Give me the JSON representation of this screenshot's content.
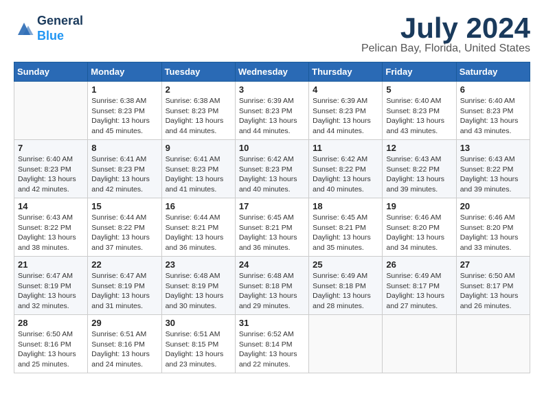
{
  "header": {
    "logo_line1": "General",
    "logo_line2": "Blue",
    "month": "July 2024",
    "location": "Pelican Bay, Florida, United States"
  },
  "weekdays": [
    "Sunday",
    "Monday",
    "Tuesday",
    "Wednesday",
    "Thursday",
    "Friday",
    "Saturday"
  ],
  "weeks": [
    [
      {
        "day": "",
        "info": ""
      },
      {
        "day": "1",
        "info": "Sunrise: 6:38 AM\nSunset: 8:23 PM\nDaylight: 13 hours\nand 45 minutes."
      },
      {
        "day": "2",
        "info": "Sunrise: 6:38 AM\nSunset: 8:23 PM\nDaylight: 13 hours\nand 44 minutes."
      },
      {
        "day": "3",
        "info": "Sunrise: 6:39 AM\nSunset: 8:23 PM\nDaylight: 13 hours\nand 44 minutes."
      },
      {
        "day": "4",
        "info": "Sunrise: 6:39 AM\nSunset: 8:23 PM\nDaylight: 13 hours\nand 44 minutes."
      },
      {
        "day": "5",
        "info": "Sunrise: 6:40 AM\nSunset: 8:23 PM\nDaylight: 13 hours\nand 43 minutes."
      },
      {
        "day": "6",
        "info": "Sunrise: 6:40 AM\nSunset: 8:23 PM\nDaylight: 13 hours\nand 43 minutes."
      }
    ],
    [
      {
        "day": "7",
        "info": "Sunrise: 6:40 AM\nSunset: 8:23 PM\nDaylight: 13 hours\nand 42 minutes."
      },
      {
        "day": "8",
        "info": "Sunrise: 6:41 AM\nSunset: 8:23 PM\nDaylight: 13 hours\nand 42 minutes."
      },
      {
        "day": "9",
        "info": "Sunrise: 6:41 AM\nSunset: 8:23 PM\nDaylight: 13 hours\nand 41 minutes."
      },
      {
        "day": "10",
        "info": "Sunrise: 6:42 AM\nSunset: 8:23 PM\nDaylight: 13 hours\nand 40 minutes."
      },
      {
        "day": "11",
        "info": "Sunrise: 6:42 AM\nSunset: 8:22 PM\nDaylight: 13 hours\nand 40 minutes."
      },
      {
        "day": "12",
        "info": "Sunrise: 6:43 AM\nSunset: 8:22 PM\nDaylight: 13 hours\nand 39 minutes."
      },
      {
        "day": "13",
        "info": "Sunrise: 6:43 AM\nSunset: 8:22 PM\nDaylight: 13 hours\nand 39 minutes."
      }
    ],
    [
      {
        "day": "14",
        "info": "Sunrise: 6:43 AM\nSunset: 8:22 PM\nDaylight: 13 hours\nand 38 minutes."
      },
      {
        "day": "15",
        "info": "Sunrise: 6:44 AM\nSunset: 8:22 PM\nDaylight: 13 hours\nand 37 minutes."
      },
      {
        "day": "16",
        "info": "Sunrise: 6:44 AM\nSunset: 8:21 PM\nDaylight: 13 hours\nand 36 minutes."
      },
      {
        "day": "17",
        "info": "Sunrise: 6:45 AM\nSunset: 8:21 PM\nDaylight: 13 hours\nand 36 minutes."
      },
      {
        "day": "18",
        "info": "Sunrise: 6:45 AM\nSunset: 8:21 PM\nDaylight: 13 hours\nand 35 minutes."
      },
      {
        "day": "19",
        "info": "Sunrise: 6:46 AM\nSunset: 8:20 PM\nDaylight: 13 hours\nand 34 minutes."
      },
      {
        "day": "20",
        "info": "Sunrise: 6:46 AM\nSunset: 8:20 PM\nDaylight: 13 hours\nand 33 minutes."
      }
    ],
    [
      {
        "day": "21",
        "info": "Sunrise: 6:47 AM\nSunset: 8:19 PM\nDaylight: 13 hours\nand 32 minutes."
      },
      {
        "day": "22",
        "info": "Sunrise: 6:47 AM\nSunset: 8:19 PM\nDaylight: 13 hours\nand 31 minutes."
      },
      {
        "day": "23",
        "info": "Sunrise: 6:48 AM\nSunset: 8:19 PM\nDaylight: 13 hours\nand 30 minutes."
      },
      {
        "day": "24",
        "info": "Sunrise: 6:48 AM\nSunset: 8:18 PM\nDaylight: 13 hours\nand 29 minutes."
      },
      {
        "day": "25",
        "info": "Sunrise: 6:49 AM\nSunset: 8:18 PM\nDaylight: 13 hours\nand 28 minutes."
      },
      {
        "day": "26",
        "info": "Sunrise: 6:49 AM\nSunset: 8:17 PM\nDaylight: 13 hours\nand 27 minutes."
      },
      {
        "day": "27",
        "info": "Sunrise: 6:50 AM\nSunset: 8:17 PM\nDaylight: 13 hours\nand 26 minutes."
      }
    ],
    [
      {
        "day": "28",
        "info": "Sunrise: 6:50 AM\nSunset: 8:16 PM\nDaylight: 13 hours\nand 25 minutes."
      },
      {
        "day": "29",
        "info": "Sunrise: 6:51 AM\nSunset: 8:16 PM\nDaylight: 13 hours\nand 24 minutes."
      },
      {
        "day": "30",
        "info": "Sunrise: 6:51 AM\nSunset: 8:15 PM\nDaylight: 13 hours\nand 23 minutes."
      },
      {
        "day": "31",
        "info": "Sunrise: 6:52 AM\nSunset: 8:14 PM\nDaylight: 13 hours\nand 22 minutes."
      },
      {
        "day": "",
        "info": ""
      },
      {
        "day": "",
        "info": ""
      },
      {
        "day": "",
        "info": ""
      }
    ]
  ]
}
